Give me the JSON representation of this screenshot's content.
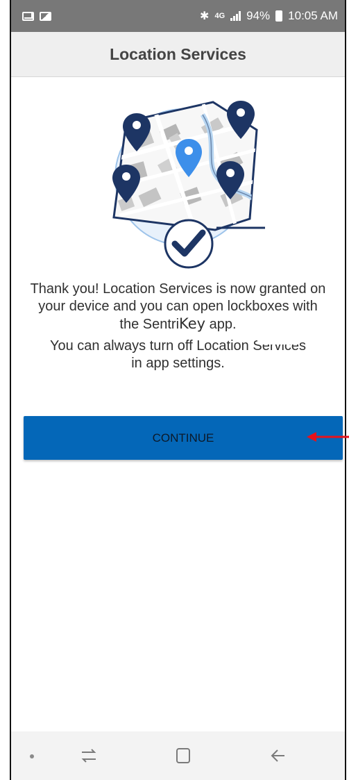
{
  "status_bar": {
    "left_icons": [
      "mail-icon",
      "photo-icon"
    ],
    "right_icons": [
      "bluetooth-icon",
      "lte-icon",
      "signal-icon",
      "battery-icon"
    ],
    "network": "4G",
    "battery_percent": "94%",
    "time": "10:05 AM"
  },
  "header": {
    "title": "Location Services"
  },
  "illustration": {
    "icon": "map-check-icon"
  },
  "message": {
    "line1": "Thank you! Location Services is now granted on",
    "line2": "your device and you can open lockboxes with",
    "line3_prefix": "the Sentri",
    "line3_app": "Key",
    "line3_suffix": " app.",
    "line4": "You can always turn off Location Services",
    "line5": "in app settings."
  },
  "continue_button": {
    "label": "CONTINUE"
  },
  "nav_bar": {
    "items": [
      "dot-icon",
      "recent-apps-icon",
      "home-icon",
      "back-icon"
    ]
  },
  "colors": {
    "accent": "#0467b8",
    "header_bg": "#efefef",
    "status_bar_bg": "#787878",
    "annotation": "#e8121b",
    "pin_dark": "#1d3564",
    "pin_light": "#3d8fea"
  }
}
